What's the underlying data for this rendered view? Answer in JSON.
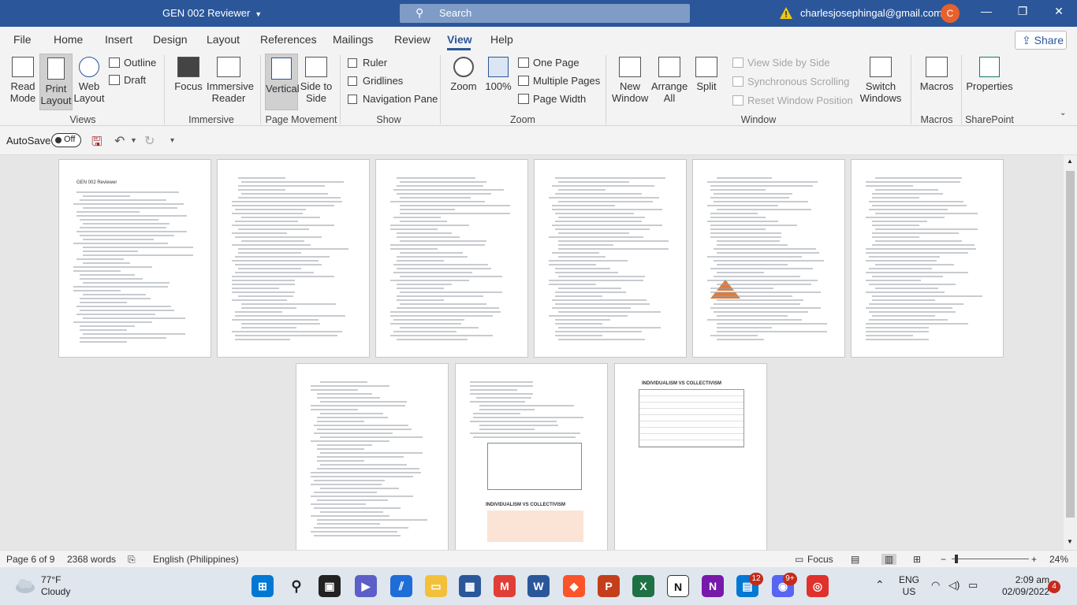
{
  "titlebar": {
    "doc_title": "GEN 002 Reviewer",
    "search_placeholder": "Search",
    "email": "charlesjosephingal@gmail.com",
    "avatar_initial": "C"
  },
  "menu": {
    "tabs": [
      "File",
      "Home",
      "Insert",
      "Design",
      "Layout",
      "References",
      "Mailings",
      "Review",
      "View",
      "Help"
    ],
    "active_tab": "View",
    "share_label": "Share"
  },
  "ribbon": {
    "views": {
      "read_mode": "Read Mode",
      "print_layout": "Print Layout",
      "web_layout": "Web Layout",
      "outline": "Outline",
      "draft": "Draft",
      "group": "Views"
    },
    "immersive": {
      "focus": "Focus",
      "immersive_reader": "Immersive Reader",
      "group": "Immersive"
    },
    "page_movement": {
      "vertical": "Vertical",
      "side_to_side": "Side to Side",
      "group": "Page Movement"
    },
    "show": {
      "ruler": "Ruler",
      "gridlines": "Gridlines",
      "navigation_pane": "Navigation Pane",
      "group": "Show"
    },
    "zoom": {
      "zoom": "Zoom",
      "percent": "100%",
      "one_page": "One Page",
      "multiple_pages": "Multiple Pages",
      "page_width": "Page Width",
      "group": "Zoom"
    },
    "window": {
      "new_window": "New Window",
      "arrange_all": "Arrange All",
      "split": "Split",
      "view_side_by_side": "View Side by Side",
      "synchronous_scrolling": "Synchronous Scrolling",
      "reset_window_position": "Reset Window Position",
      "switch_windows": "Switch Windows",
      "group": "Window"
    },
    "macros": {
      "macros": "Macros",
      "group": "Macros"
    },
    "sharepoint": {
      "properties": "Properties",
      "group": "SharePoint"
    }
  },
  "qat": {
    "autosave_label": "AutoSave",
    "autosave_state": "Off"
  },
  "document": {
    "page1_heading": "GEN 002 Reviewer",
    "page9_table_title": "INDIVIDUALISM VS COLLECTIVISM",
    "page8_table_title": "INDIVIDUALISM VS COLLECTIVISM"
  },
  "status": {
    "page": "Page 6 of 9",
    "words": "2368 words",
    "language": "English (Philippines)",
    "focus": "Focus",
    "zoom": "24%"
  },
  "taskbar": {
    "temp": "77°F",
    "condition": "Cloudy",
    "lang1": "ENG",
    "lang2": "US",
    "time": "2:09 am",
    "date": "02/09/2022",
    "badge_teams": "12",
    "badge_discord": "9+",
    "badge_notif": "4"
  }
}
